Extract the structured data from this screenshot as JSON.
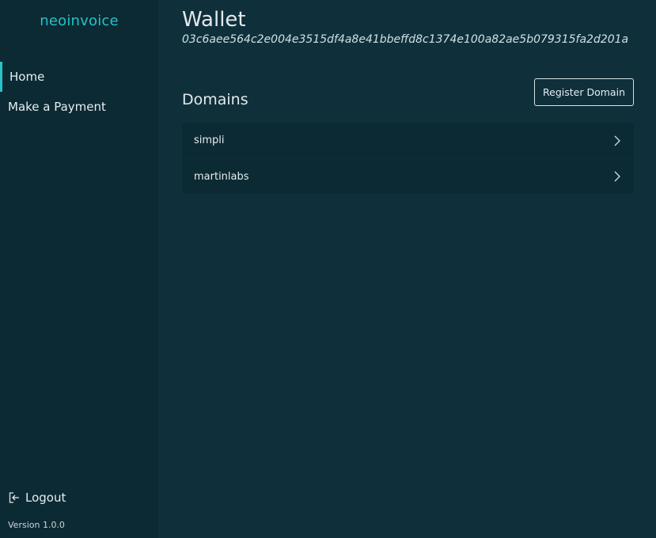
{
  "app": {
    "brand": "neoinvoice",
    "version": "Version 1.0.0",
    "accent": "#26c2c7"
  },
  "sidebar": {
    "items": [
      {
        "label": "Home",
        "active": true
      },
      {
        "label": "Make a Payment",
        "active": false
      }
    ],
    "logout_label": "Logout",
    "logout_icon": "logout-icon"
  },
  "main": {
    "title": "Wallet",
    "address": "03c6aee564c2e004e3515df4a8e41bbeffd8c1374e100a82ae5b079315fa2d201a",
    "domains_title": "Domains",
    "register_label": "Register Domain",
    "domains": [
      {
        "name": "simpli",
        "icon": "chevron-right-icon"
      },
      {
        "name": "martinlabs",
        "icon": "chevron-right-icon"
      }
    ]
  }
}
